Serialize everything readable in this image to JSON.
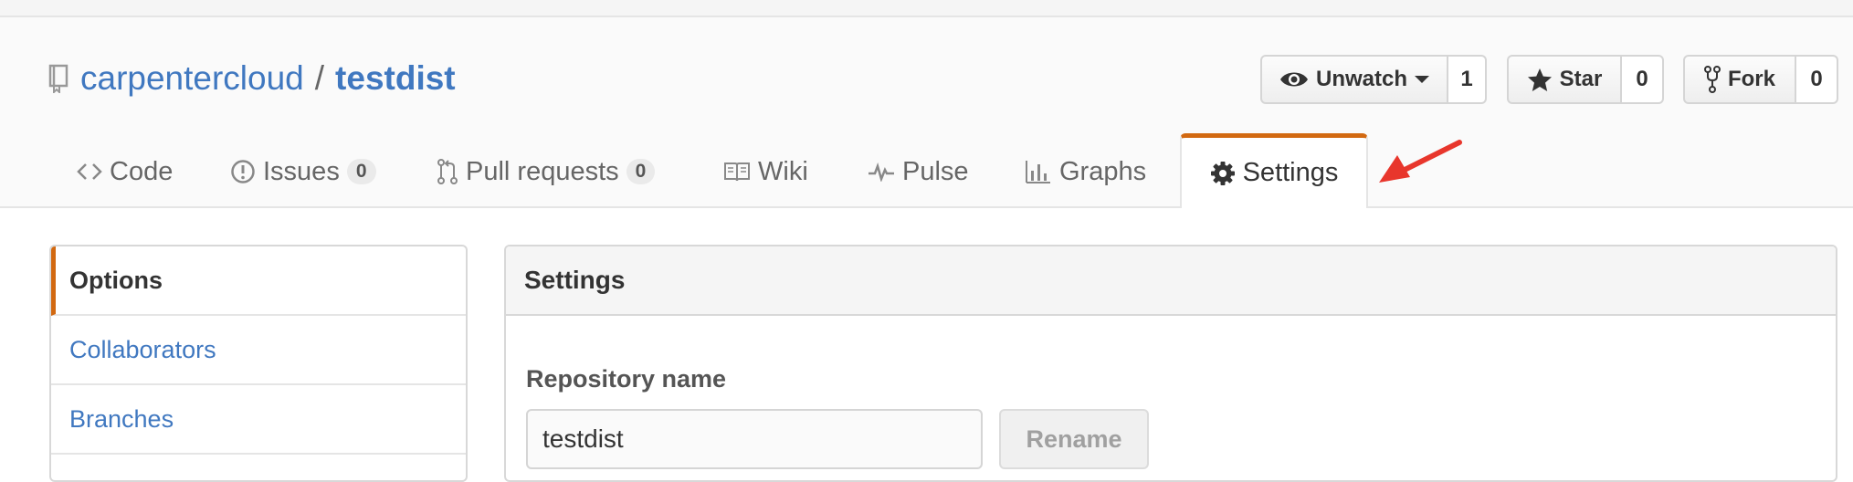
{
  "repo": {
    "owner": "carpentercloud",
    "separator": "/",
    "name": "testdist"
  },
  "actions": {
    "watch": {
      "label": "Unwatch",
      "count": "1"
    },
    "star": {
      "label": "Star",
      "count": "0"
    },
    "fork": {
      "label": "Fork",
      "count": "0"
    }
  },
  "tabs": [
    {
      "label": "Code",
      "icon": "code-icon"
    },
    {
      "label": "Issues",
      "icon": "issue-icon",
      "count": "0"
    },
    {
      "label": "Pull requests",
      "icon": "pull-request-icon",
      "count": "0"
    },
    {
      "label": "Wiki",
      "icon": "book-icon"
    },
    {
      "label": "Pulse",
      "icon": "pulse-icon"
    },
    {
      "label": "Graphs",
      "icon": "graph-icon"
    },
    {
      "label": "Settings",
      "icon": "gear-icon",
      "selected": true
    }
  ],
  "sidebar": {
    "items": [
      {
        "label": "Options",
        "active": true
      },
      {
        "label": "Collaborators"
      },
      {
        "label": "Branches"
      }
    ]
  },
  "settings": {
    "title": "Settings",
    "repo_name_label": "Repository name",
    "repo_name_value": "testdist",
    "rename_label": "Rename"
  },
  "colors": {
    "link": "#4078c0",
    "accent": "#d26911",
    "annotation": "#e8362c"
  }
}
